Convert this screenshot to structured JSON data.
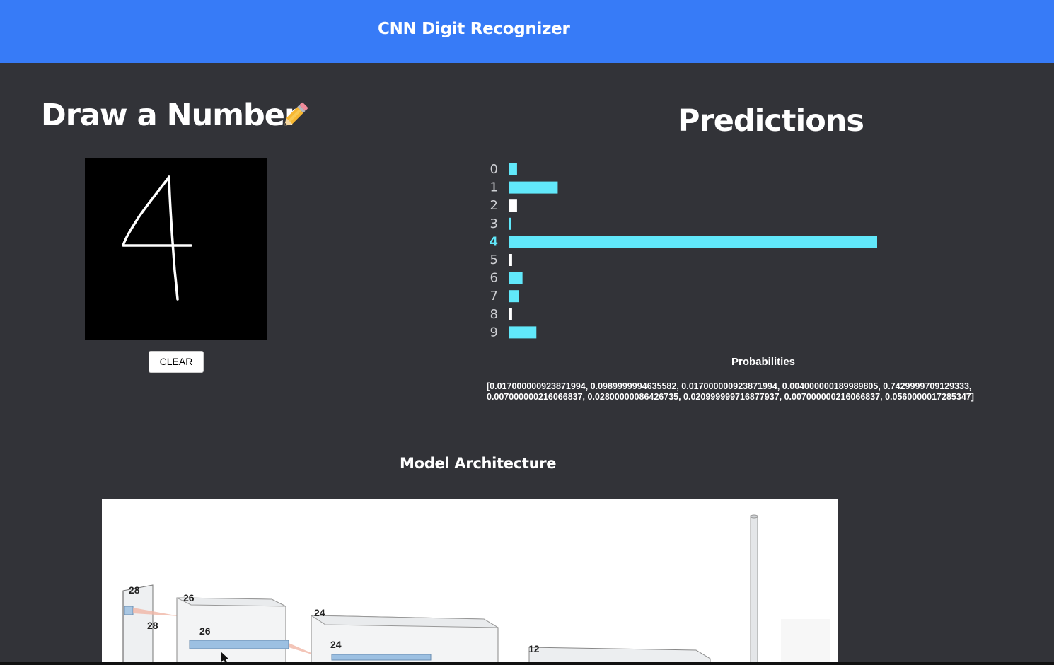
{
  "header": {
    "title": "CNN Digit Recognizer"
  },
  "draw_panel": {
    "title": "Draw a Number",
    "title_icon": "pencil-icon",
    "clear_label": "CLEAR"
  },
  "predictions_panel": {
    "title": "Predictions",
    "probabilities_heading": "Probabilities",
    "probabilities_text": "[0.017000000923871994, 0.0989999994635582, 0.017000000923871994, 0.004000000189989805, 0.7429999709129333, 0.007000000216066837, 0.02800000086426735, 0.020999999716877937, 0.007000000216066837, 0.0560000017285347]"
  },
  "architecture": {
    "title": "Model Architecture",
    "labels": [
      "28",
      "28",
      "26",
      "26",
      "24",
      "24",
      "12"
    ]
  },
  "chart_data": {
    "type": "bar",
    "orientation": "horizontal",
    "categories": [
      "0",
      "1",
      "2",
      "3",
      "4",
      "5",
      "6",
      "7",
      "8",
      "9"
    ],
    "values": [
      0.017000000923871994,
      0.0989999994635582,
      0.017000000923871994,
      0.004000000189989805,
      0.7429999709129333,
      0.007000000216066837,
      0.02800000086426735,
      0.020999999716877937,
      0.007000000216066837,
      0.0560000017285347
    ],
    "bar_colors": [
      "#61e8fa",
      "#61e8fa",
      "#ffffff",
      "#61e8fa",
      "#61e8fa",
      "#ffffff",
      "#61e8fa",
      "#61e8fa",
      "#ffffff",
      "#61e8fa"
    ],
    "highlighted_category": "4",
    "highlight_color": "#61e8fa",
    "label_color": "#cfd0d4",
    "xlim": [
      0,
      0.743
    ]
  }
}
